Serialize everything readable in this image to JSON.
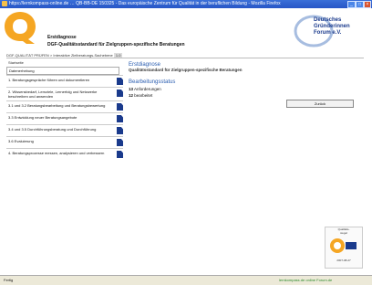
{
  "window": {
    "title": "https://lernkompass-online.de … QB-BB-DE 150325 - Das europäische Zentrum für Qualität in der beruflichen Bildung - Mozilla Firefox"
  },
  "header": {
    "app_title": "Erstdiagnose",
    "app_subtitle": "DGF-Qualitätsstandard für Zielgruppen-spezifische Beratungen",
    "partner_logo_text": [
      "Deutsches",
      "Gründerinnen",
      "Forum e.V."
    ]
  },
  "breadcrumb": {
    "text": "DGF-QUALITÄT PRÜFEN > Interaktive Zielberatungs-Sachebene",
    "version": "1.0"
  },
  "sidebar": {
    "heading": "Startseite",
    "select_value": "Datenerhebung",
    "items": [
      {
        "label": "1. Beratungsgespräche führen und dokumentieren"
      },
      {
        "label": "2. Wissensbedarf, Lernziele, Lernerfolg und Netzwerke beschreiben und anwenden"
      },
      {
        "label": "3.1 und 3.2 Beratungsbearbeitung und Beratungsbewertung"
      },
      {
        "label": "3.3 Entwicklung neuer Beratungsangebote"
      },
      {
        "label": "3.4 und 3.5 Durchführungsberatung und Durchführung"
      },
      {
        "label": "3.6 Evaluierung"
      },
      {
        "label": "4. Beratungsprozesse messen, analysieren und verbessern"
      }
    ]
  },
  "content": {
    "title": "Erstdiagnose",
    "subtitle": "Qualitätsstandard für Zielgruppen-spezifische Beratungen",
    "section_title": "Bearbeitungsstatus",
    "lines": [
      {
        "count": "13",
        "label": "Anforderungen"
      },
      {
        "count": "12",
        "label": "bearbeitet"
      }
    ]
  },
  "back_button": {
    "label": "Zurück"
  },
  "seal": {
    "top": "Qualitäts-",
    "mid": "siegel",
    "year": "2007-08-27"
  },
  "status": {
    "left": "Fertig",
    "right": "lernkompass.de online Forum.de"
  },
  "colors": {
    "accent": "#2a5db0",
    "brand": "#f5a623",
    "partner": "#1a3a8c"
  }
}
